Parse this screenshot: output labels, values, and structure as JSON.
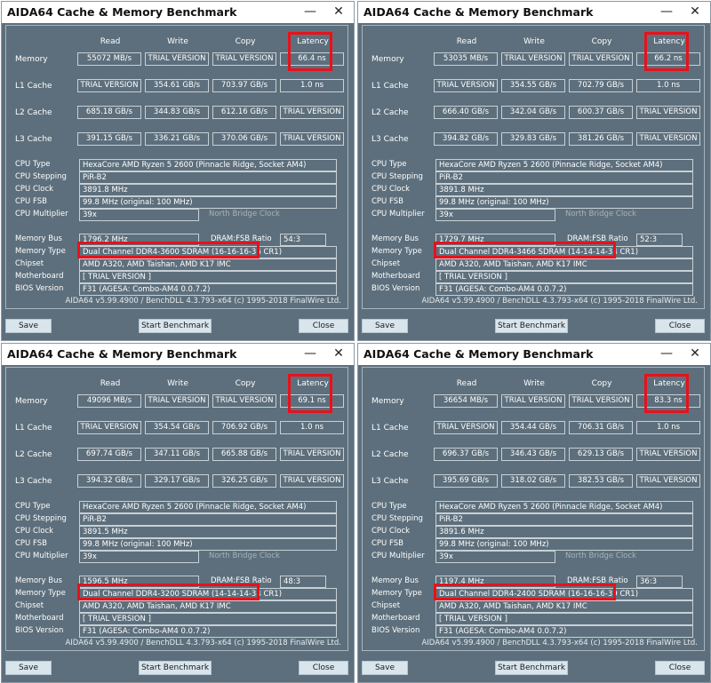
{
  "windows": [
    {
      "title": "AIDA64 Cache & Memory Benchmark",
      "headers": {
        "read": "Read",
        "write": "Write",
        "copy": "Copy",
        "latency": "Latency"
      },
      "rows": [
        {
          "label": "Memory",
          "read": "55072 MB/s",
          "write": "TRIAL VERSION",
          "copy": "TRIAL VERSION",
          "latency": "66.4 ns"
        },
        {
          "label": "L1 Cache",
          "read": "TRIAL VERSION",
          "write": "354.61 GB/s",
          "copy": "703.97 GB/s",
          "latency": "1.0 ns"
        },
        {
          "label": "L2 Cache",
          "read": "685.18 GB/s",
          "write": "344.83 GB/s",
          "copy": "612.16 GB/s",
          "latency": "TRIAL VERSION"
        },
        {
          "label": "L3 Cache",
          "read": "391.15 GB/s",
          "write": "336.21 GB/s",
          "copy": "370.06 GB/s",
          "latency": "TRIAL VERSION"
        }
      ],
      "info": {
        "cpu_type_label": "CPU Type",
        "cpu_type": "HexaCore AMD Ryzen 5 2600  (Pinnacle Ridge, Socket AM4)",
        "cpu_stepping_label": "CPU Stepping",
        "cpu_stepping": "PiR-B2",
        "cpu_clock_label": "CPU Clock",
        "cpu_clock": "3891.8 MHz",
        "cpu_fsb_label": "CPU FSB",
        "cpu_fsb": "99.8 MHz  (original: 100 MHz)",
        "cpu_mult_label": "CPU Multiplier",
        "cpu_mult": "39x",
        "nb_clock_label": "North Bridge Clock",
        "mem_bus_label": "Memory Bus",
        "mem_bus": "1796.2 MHz",
        "dram_fsb_label": "DRAM:FSB Ratio",
        "dram_fsb": "54:3",
        "mem_type_label": "Memory Type",
        "mem_type": "Dual Channel DDR4-3600 SDRAM  (16-16-16-36 CR1)",
        "chipset_label": "Chipset",
        "chipset": "AMD A320, AMD Taishan, AMD K17 IMC",
        "mobo_label": "Motherboard",
        "mobo": "[ TRIAL VERSION ]",
        "bios_label": "BIOS Version",
        "bios": "F31  (AGESA: Combo-AM4 0.0.7.2)"
      },
      "footer": "AIDA64 v5.99.4900 / BenchDLL 4.3.793-x64  (c) 1995-2018 FinalWire Ltd.",
      "buttons": {
        "save": "Save",
        "start": "Start Benchmark",
        "close": "Close"
      }
    },
    {
      "title": "AIDA64 Cache & Memory Benchmark",
      "headers": {
        "read": "Read",
        "write": "Write",
        "copy": "Copy",
        "latency": "Latency"
      },
      "rows": [
        {
          "label": "Memory",
          "read": "53035 MB/s",
          "write": "TRIAL VERSION",
          "copy": "TRIAL VERSION",
          "latency": "66.2 ns"
        },
        {
          "label": "L1 Cache",
          "read": "TRIAL VERSION",
          "write": "354.55 GB/s",
          "copy": "702.79 GB/s",
          "latency": "1.0 ns"
        },
        {
          "label": "L2 Cache",
          "read": "666.40 GB/s",
          "write": "342.04 GB/s",
          "copy": "600.37 GB/s",
          "latency": "TRIAL VERSION"
        },
        {
          "label": "L3 Cache",
          "read": "394.82 GB/s",
          "write": "329.83 GB/s",
          "copy": "381.26 GB/s",
          "latency": "TRIAL VERSION"
        }
      ],
      "info": {
        "cpu_type_label": "CPU Type",
        "cpu_type": "HexaCore AMD Ryzen 5 2600  (Pinnacle Ridge, Socket AM4)",
        "cpu_stepping_label": "CPU Stepping",
        "cpu_stepping": "PiR-B2",
        "cpu_clock_label": "CPU Clock",
        "cpu_clock": "3891.8 MHz",
        "cpu_fsb_label": "CPU FSB",
        "cpu_fsb": "99.8 MHz  (original: 100 MHz)",
        "cpu_mult_label": "CPU Multiplier",
        "cpu_mult": "39x",
        "nb_clock_label": "North Bridge Clock",
        "mem_bus_label": "Memory Bus",
        "mem_bus": "1729.7 MHz",
        "dram_fsb_label": "DRAM:FSB Ratio",
        "dram_fsb": "52:3",
        "mem_type_label": "Memory Type",
        "mem_type": "Dual Channel DDR4-3466 SDRAM  (14-14-14-34 CR1)",
        "chipset_label": "Chipset",
        "chipset": "AMD A320, AMD Taishan, AMD K17 IMC",
        "mobo_label": "Motherboard",
        "mobo": "[ TRIAL VERSION ]",
        "bios_label": "BIOS Version",
        "bios": "F31  (AGESA: Combo-AM4 0.0.7.2)"
      },
      "footer": "AIDA64 v5.99.4900 / BenchDLL 4.3.793-x64  (c) 1995-2018 FinalWire Ltd.",
      "buttons": {
        "save": "Save",
        "start": "Start Benchmark",
        "close": "Close"
      }
    },
    {
      "title": "AIDA64 Cache & Memory Benchmark",
      "headers": {
        "read": "Read",
        "write": "Write",
        "copy": "Copy",
        "latency": "Latency"
      },
      "rows": [
        {
          "label": "Memory",
          "read": "49096 MB/s",
          "write": "TRIAL VERSION",
          "copy": "TRIAL VERSION",
          "latency": "69.1 ns"
        },
        {
          "label": "L1 Cache",
          "read": "TRIAL VERSION",
          "write": "354.54 GB/s",
          "copy": "706.92 GB/s",
          "latency": "1.0 ns"
        },
        {
          "label": "L2 Cache",
          "read": "697.74 GB/s",
          "write": "347.11 GB/s",
          "copy": "665.88 GB/s",
          "latency": "TRIAL VERSION"
        },
        {
          "label": "L3 Cache",
          "read": "394.32 GB/s",
          "write": "329.17 GB/s",
          "copy": "326.25 GB/s",
          "latency": "TRIAL VERSION"
        }
      ],
      "info": {
        "cpu_type_label": "CPU Type",
        "cpu_type": "HexaCore AMD Ryzen 5 2600  (Pinnacle Ridge, Socket AM4)",
        "cpu_stepping_label": "CPU Stepping",
        "cpu_stepping": "PiR-B2",
        "cpu_clock_label": "CPU Clock",
        "cpu_clock": "3891.5 MHz",
        "cpu_fsb_label": "CPU FSB",
        "cpu_fsb": "99.8 MHz  (original: 100 MHz)",
        "cpu_mult_label": "CPU Multiplier",
        "cpu_mult": "39x",
        "nb_clock_label": "North Bridge Clock",
        "mem_bus_label": "Memory Bus",
        "mem_bus": "1596.5 MHz",
        "dram_fsb_label": "DRAM:FSB Ratio",
        "dram_fsb": "48:3",
        "mem_type_label": "Memory Type",
        "mem_type": "Dual Channel DDR4-3200 SDRAM  (14-14-14-34 CR1)",
        "chipset_label": "Chipset",
        "chipset": "AMD A320, AMD Taishan, AMD K17 IMC",
        "mobo_label": "Motherboard",
        "mobo": "[ TRIAL VERSION ]",
        "bios_label": "BIOS Version",
        "bios": "F31  (AGESA: Combo-AM4 0.0.7.2)"
      },
      "footer": "AIDA64 v5.99.4900 / BenchDLL 4.3.793-x64  (c) 1995-2018 FinalWire Ltd.",
      "buttons": {
        "save": "Save",
        "start": "Start Benchmark",
        "close": "Close"
      }
    },
    {
      "title": "AIDA64 Cache & Memory Benchmark",
      "headers": {
        "read": "Read",
        "write": "Write",
        "copy": "Copy",
        "latency": "Latency"
      },
      "rows": [
        {
          "label": "Memory",
          "read": "36654 MB/s",
          "write": "TRIAL VERSION",
          "copy": "TRIAL VERSION",
          "latency": "83.3 ns"
        },
        {
          "label": "L1 Cache",
          "read": "TRIAL VERSION",
          "write": "354.44 GB/s",
          "copy": "706.31 GB/s",
          "latency": "1.0 ns"
        },
        {
          "label": "L2 Cache",
          "read": "696.37 GB/s",
          "write": "346.43 GB/s",
          "copy": "629.13 GB/s",
          "latency": "TRIAL VERSION"
        },
        {
          "label": "L3 Cache",
          "read": "395.69 GB/s",
          "write": "318.02 GB/s",
          "copy": "382.53 GB/s",
          "latency": "TRIAL VERSION"
        }
      ],
      "info": {
        "cpu_type_label": "CPU Type",
        "cpu_type": "HexaCore AMD Ryzen 5 2600  (Pinnacle Ridge, Socket AM4)",
        "cpu_stepping_label": "CPU Stepping",
        "cpu_stepping": "PiR-B2",
        "cpu_clock_label": "CPU Clock",
        "cpu_clock": "3891.6 MHz",
        "cpu_fsb_label": "CPU FSB",
        "cpu_fsb": "99.8 MHz  (original: 100 MHz)",
        "cpu_mult_label": "CPU Multiplier",
        "cpu_mult": "39x",
        "nb_clock_label": "North Bridge Clock",
        "mem_bus_label": "Memory Bus",
        "mem_bus": "1197.4 MHz",
        "dram_fsb_label": "DRAM:FSB Ratio",
        "dram_fsb": "36:3",
        "mem_type_label": "Memory Type",
        "mem_type": "Dual Channel DDR4-2400 SDRAM  (16-16-16-39 CR1)",
        "chipset_label": "Chipset",
        "chipset": "AMD A320, AMD Taishan, AMD K17 IMC",
        "mobo_label": "Motherboard",
        "mobo": "[ TRIAL VERSION ]",
        "bios_label": "BIOS Version",
        "bios": "F31  (AGESA: Combo-AM4 0.0.7.2)"
      },
      "footer": "AIDA64 v5.99.4900 / BenchDLL 4.3.793-x64  (c) 1995-2018 FinalWire Ltd.",
      "buttons": {
        "save": "Save",
        "start": "Start Benchmark",
        "close": "Close"
      }
    }
  ],
  "titlebar_icons": {
    "minimize": "minimize-icon",
    "close": "close-icon"
  },
  "colors": {
    "window_bg": "#5d6f7c",
    "highlight": "#e8111a",
    "button_bg": "#d9e5ec"
  }
}
